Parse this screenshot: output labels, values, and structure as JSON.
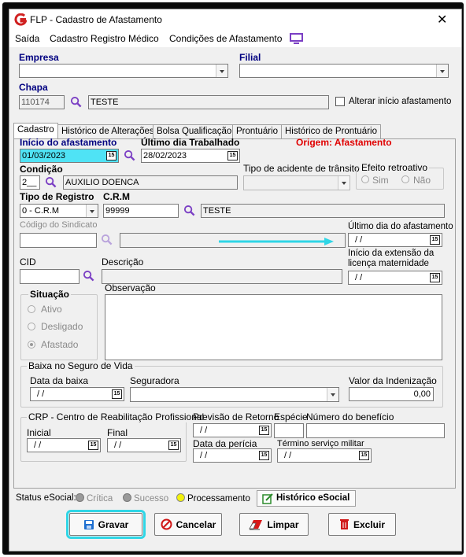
{
  "window": {
    "title": "FLP - Cadastro de Afastamento",
    "close": "✕"
  },
  "menu": {
    "saida": "Saída",
    "cadastro_medico": "Cadastro Registro Médico",
    "condicoes": "Condições de Afastamento"
  },
  "top": {
    "empresa_label": "Empresa",
    "empresa_value": "",
    "filial_label": "Filial",
    "filial_value": "",
    "chapa_label": "Chapa",
    "chapa_value": "110174",
    "chapa_name": "TESTE",
    "alterar_label": "Alterar início afastamento",
    "alterar_checked": false
  },
  "tabs": [
    "Cadastro",
    "Histórico de Alterações",
    "Bolsa Qualificação",
    "Prontuário",
    "Histórico de Prontuário"
  ],
  "form": {
    "inicio_label": "Início do afastamento",
    "inicio_value": "01/03/2023",
    "ultimo_trab_label": "Último dia Trabalhado",
    "ultimo_trab_value": "28/02/2023",
    "origem_label": "Origem: Afastamento",
    "condicao_label": "Condição",
    "condicao_code": "2__",
    "condicao_desc": "AUXILIO DOENCA",
    "acidente_label": "Tipo de acidente de trânsito",
    "acidente_value": "",
    "efeito_label": "Efeito retroativo",
    "efeito_sim": "Sim",
    "efeito_nao": "Não",
    "tipo_registro_label": "Tipo de Registro",
    "tipo_registro_value": "0 - C.R.M",
    "crm_label": "C.R.M",
    "crm_value": "99999",
    "crm_name": "TESTE",
    "sindicato_label": "Código do Sindicato",
    "sindicato_value": "",
    "sindicato_desc": "",
    "ultimo_afast_label": "Último dia do afastamento",
    "ultimo_afast_value": "/ /",
    "inicio_ext_label_1": "Início da extensão da",
    "inicio_ext_label_2": "licença maternidade",
    "inicio_ext_value": "/ /",
    "cid_label": "CID",
    "cid_value": "",
    "descricao_label": "Descrição",
    "descricao_value": "",
    "observacao_label": "Observação",
    "observacao_value": "",
    "situacao_label": "Situação",
    "situacao_options": [
      "Ativo",
      "Desligado",
      "Afastado"
    ],
    "situacao_selected": "Afastado",
    "cal_glyph": "15"
  },
  "baixa": {
    "title": "Baixa no Seguro de Vida",
    "data_label": "Data da baixa",
    "data_value": "/ /",
    "seguradora_label": "Seguradora",
    "seguradora_value": "",
    "valor_label": "Valor da Indenização",
    "valor_value": "0,00"
  },
  "crp": {
    "title": "CRP - Centro de Reabilitação Profissional",
    "inicial_label": "Inicial",
    "inicial_value": "/ /",
    "final_label": "Final",
    "final_value": "/ /",
    "previsao_label": "Previsão de Retorno",
    "previsao_value": "/ /",
    "especie_label": "Espécie",
    "especie_value": "",
    "numero_label": "Número do benefício",
    "numero_value": "",
    "pericia_label": "Data da perícia",
    "pericia_value": "/ /",
    "termino_label": "Término serviço militar",
    "termino_value": "/ /"
  },
  "status": {
    "label": "Status eSocial:",
    "critica": "Crítica",
    "sucesso": "Sucesso",
    "processamento": "Processamento",
    "historico": "Histórico eSocial",
    "color_critica": "#9a9a9a",
    "color_sucesso": "#9a9a9a",
    "color_processamento": "#f2f20a"
  },
  "buttons": {
    "gravar": "Gravar",
    "cancelar": "Cancelar",
    "limpar": "Limpar",
    "excluir": "Excluir"
  },
  "colors": {
    "accent_cyan": "#4fe3f5",
    "label_blue": "#000080",
    "origem_red": "#e00000",
    "icon_purple": "#7b3fc4"
  }
}
